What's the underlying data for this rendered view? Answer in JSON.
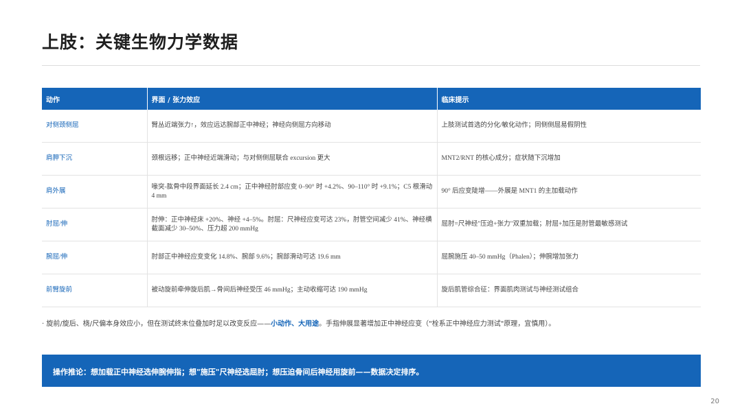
{
  "title": "上肢：关键生物力学数据",
  "table": {
    "headers": [
      "动作",
      "界面 / 张力效应",
      "临床提示"
    ],
    "rows": [
      {
        "action": "对侧颈侧屈",
        "effect": "臂丛近端张力↑，效应远达腕部正中神经；神经向侧屈方向移动",
        "clinical": "上肢测试首选的分化/敏化动作；同侧侧屈易假阴性"
      },
      {
        "action": "肩胛下沉",
        "effect": "颈根远移；正中神经近端滑动；与对侧侧屈联合 excursion 更大",
        "clinical": "MNT2/RNT 的核心成分；症状随下沉增加"
      },
      {
        "action": "肩外展",
        "effect": "喙突-肱骨中段界面延长 2.4 cm；正中神经肘部应变 0–90° 时 +4.2%、90–110° 时 +9.1%；C5 根滑动 4 mm",
        "clinical": "90° 后应变陡增——外展是 MNT1 的主加载动作"
      },
      {
        "action": "肘屈/伸",
        "effect": "肘伸：正中神经床 +20%、神经 +4–5%。肘屈：尺神经应变可达 23%，肘管空间减少 41%、神经横截面减少 30–50%、压力超 200 mmHg",
        "clinical": "屈肘=尺神经\"压迫+张力\"双重加载；肘屈+加压是肘管最敏感测试"
      },
      {
        "action": "腕屈/伸",
        "effect": "肘部正中神经应变变化 14.8%、腕部 9.6%；腕部滑动可达 19.6 mm",
        "clinical": "屈腕施压 40–50 mmHg（Phalen）；伸腕增加张力"
      },
      {
        "action": "前臂旋前",
        "effect": "被动旋前牵伸旋后肌→骨间后神经受压 46 mmHg；主动收缩可达 190 mmHg",
        "clinical": "旋后肌管综合征：界面肌肉测试与神经测试组合"
      }
    ]
  },
  "note": {
    "prefix": "· 旋前/旋后、桡/尺偏本身效应小，但在测试终末位叠加时足以改变反应——",
    "highlight": "小动作、大用途",
    "suffix": "。手指伸展显著增加正中神经应变（\"栓系正中神经应力测试\"原理，宜慎用）。"
  },
  "banner": "操作推论：想加载正中神经选伸腕伸指；想\"施压\"尺神经选屈肘；想压迫骨间后神经用旋前——数据决定排序。",
  "page_number": "20"
}
